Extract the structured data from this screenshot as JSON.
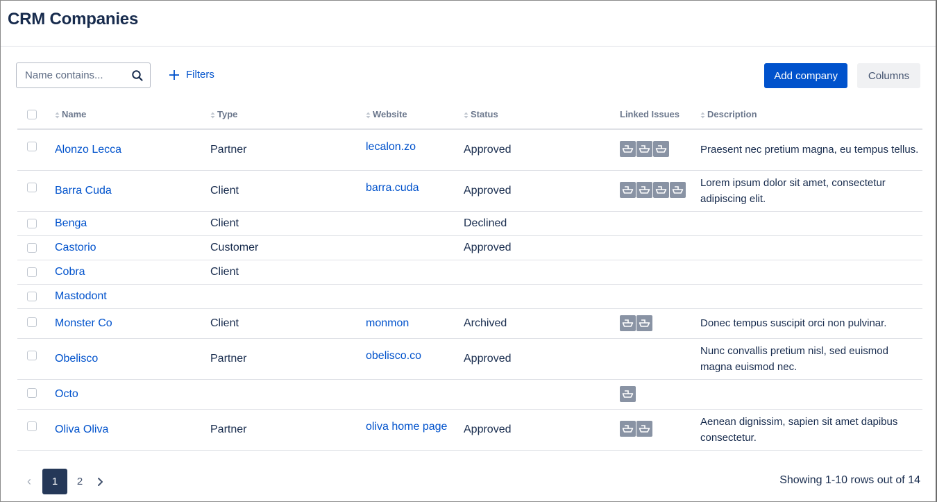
{
  "page": {
    "title": "CRM Companies"
  },
  "toolbar": {
    "search_placeholder": "Name contains...",
    "filters_label": "Filters",
    "add_label": "Add company",
    "columns_label": "Columns"
  },
  "table": {
    "headers": {
      "name": "Name",
      "type": "Type",
      "website": "Website",
      "status": "Status",
      "linked": "Linked Issues",
      "description": "Description"
    },
    "rows": [
      {
        "name": "Alonzo Lecca",
        "type": "Partner",
        "website": "lecalon.zo",
        "status": "Approved",
        "issues": 3,
        "description": "Praesent nec pretium magna, eu tempus tellus."
      },
      {
        "name": "Barra Cuda",
        "type": "Client",
        "website": "barra.cuda",
        "status": "Approved",
        "issues": 4,
        "description": "Lorem ipsum dolor sit amet, consectetur adipiscing elit."
      },
      {
        "name": "Benga",
        "type": "Client",
        "website": "",
        "status": "Declined",
        "issues": 0,
        "description": ""
      },
      {
        "name": "Castorio",
        "type": "Customer",
        "website": "",
        "status": "Approved",
        "issues": 0,
        "description": ""
      },
      {
        "name": "Cobra",
        "type": "Client",
        "website": "",
        "status": "",
        "issues": 0,
        "description": ""
      },
      {
        "name": "Mastodont",
        "type": "",
        "website": "",
        "status": "",
        "issues": 0,
        "description": ""
      },
      {
        "name": "Monster Co",
        "type": "Client",
        "website": "monmon",
        "status": "Archived",
        "issues": 2,
        "description": "Donec tempus suscipit orci non pulvinar."
      },
      {
        "name": "Obelisco",
        "type": "Partner",
        "website": "obelisco.co",
        "status": "Approved",
        "issues": 0,
        "description": "Nunc convallis pretium nisl, sed euismod magna euismod nec."
      },
      {
        "name": "Octo",
        "type": "",
        "website": "",
        "status": "",
        "issues": 1,
        "description": ""
      },
      {
        "name": "Oliva Oliva",
        "type": "Partner",
        "website": "oliva home page",
        "status": "Approved",
        "issues": 2,
        "description": "Aenean dignissim, sapien sit amet dapibus consectetur."
      }
    ]
  },
  "pagination": {
    "pages": [
      "1",
      "2"
    ],
    "current": "1",
    "summary": "Showing 1-10 rows out of 14"
  },
  "icons": {
    "search": "search-icon",
    "plus": "plus-icon",
    "sort": "sort-icon",
    "issue": "ship-icon",
    "prev": "chevron-left-icon",
    "next": "chevron-right-icon"
  },
  "colors": {
    "brand": "#0052cc",
    "title": "#172b4d",
    "issue_icon_bg": "#8993a4",
    "pager_active": "#253858"
  }
}
